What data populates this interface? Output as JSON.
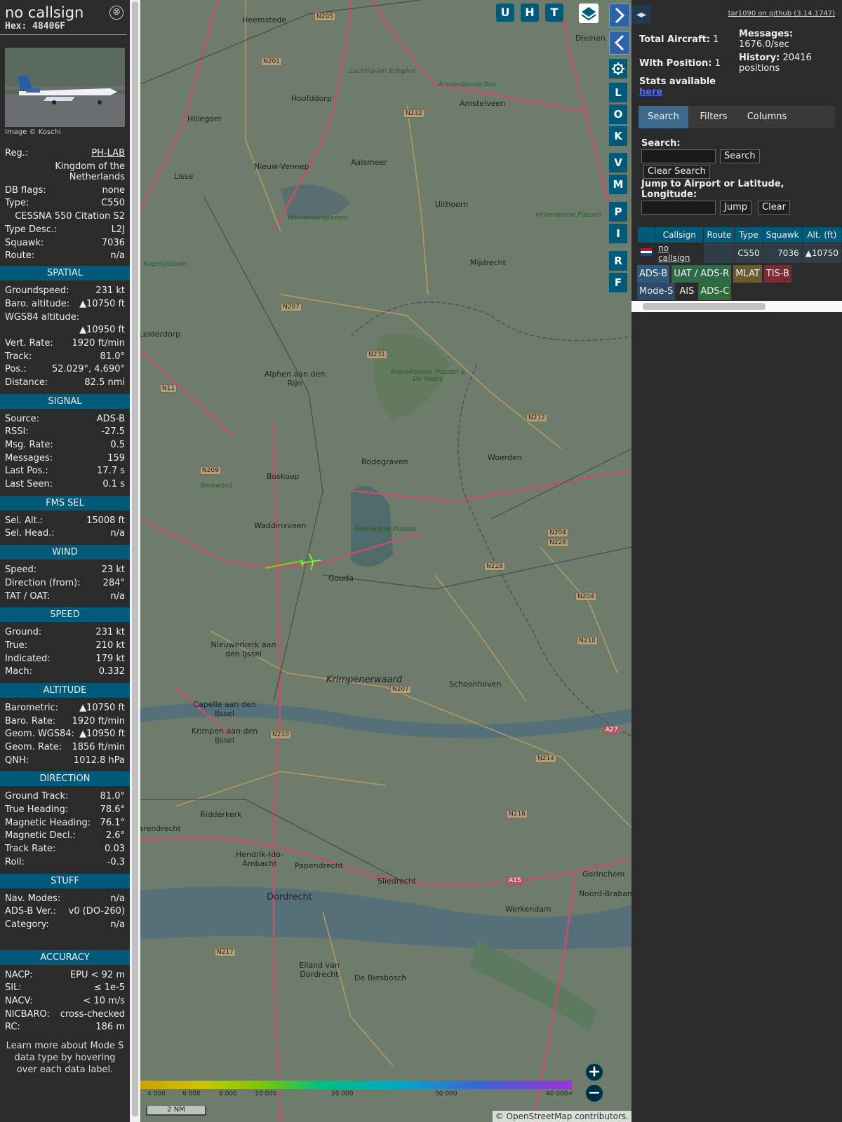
{
  "detail": {
    "callsign": "no callsign",
    "hex": "Hex: 48406F",
    "image_credit": "Image © Koschi",
    "close_symbol": "⊗",
    "main_rows": [
      {
        "k": "Reg.:",
        "v": "PH-LAB"
      },
      {
        "k": "",
        "v": "Kingdom of the Netherlands"
      },
      {
        "k": "DB flags:",
        "v": "none"
      },
      {
        "k": "Type:",
        "v": "C550"
      },
      {
        "k": "",
        "v": "CESSNA 550 Citation S2"
      },
      {
        "k": "Type Desc.:",
        "v": "L2J"
      },
      {
        "k": "Squawk:",
        "v": "7036"
      },
      {
        "k": "Route:",
        "v": "n/a"
      }
    ],
    "sections": [
      {
        "title": "SPATIAL",
        "rows": [
          {
            "k": "Groundspeed:",
            "v": "231 kt"
          },
          {
            "k": "Baro. altitude:",
            "v": "▲10750 ft"
          },
          {
            "k": "WGS84 altitude:",
            "v": ""
          },
          {
            "k": "",
            "v": "▲10950 ft"
          },
          {
            "k": "Vert. Rate:",
            "v": "1920 ft/min"
          },
          {
            "k": "Track:",
            "v": "81.0°"
          },
          {
            "k": "Pos.:",
            "v": "52.029°, 4.690°"
          },
          {
            "k": "Distance:",
            "v": "82.5 nmi"
          }
        ]
      },
      {
        "title": "SIGNAL",
        "rows": [
          {
            "k": "Source:",
            "v": "ADS-B"
          },
          {
            "k": "RSSI:",
            "v": "-27.5"
          },
          {
            "k": "Msg. Rate:",
            "v": "0.5"
          },
          {
            "k": "Messages:",
            "v": "159"
          },
          {
            "k": "Last Pos.:",
            "v": "17.7 s"
          },
          {
            "k": "Last Seen:",
            "v": "0.1 s"
          }
        ]
      },
      {
        "title": "FMS SEL",
        "rows": [
          {
            "k": "Sel. Alt.:",
            "v": "15008 ft"
          },
          {
            "k": "Sel. Head.:",
            "v": "n/a"
          }
        ]
      },
      {
        "title": "WIND",
        "rows": [
          {
            "k": "Speed:",
            "v": "23 kt"
          },
          {
            "k": "Direction (from):",
            "v": "284°"
          },
          {
            "k": "TAT / OAT:",
            "v": "n/a"
          }
        ]
      },
      {
        "title": "SPEED",
        "rows": [
          {
            "k": "Ground:",
            "v": "231 kt"
          },
          {
            "k": "True:",
            "v": "210 kt"
          },
          {
            "k": "Indicated:",
            "v": "179 kt"
          },
          {
            "k": "Mach:",
            "v": "0.332"
          }
        ]
      },
      {
        "title": "ALTITUDE",
        "rows": [
          {
            "k": "Barometric:",
            "v": "▲10750 ft"
          },
          {
            "k": "Baro. Rate:",
            "v": "1920 ft/min"
          },
          {
            "k": "Geom. WGS84:",
            "v": "▲10950 ft"
          },
          {
            "k": "Geom. Rate:",
            "v": "1856 ft/min"
          },
          {
            "k": "QNH:",
            "v": "1012.8 hPa"
          }
        ]
      },
      {
        "title": "DIRECTION",
        "rows": [
          {
            "k": "Ground Track:",
            "v": "81.0°"
          },
          {
            "k": "True Heading:",
            "v": "78.6°"
          },
          {
            "k": "Magnetic Heading:",
            "v": "76.1°"
          },
          {
            "k": "Magnetic Decl.:",
            "v": "2.6°"
          },
          {
            "k": "Track Rate:",
            "v": "0.03"
          },
          {
            "k": "Roll:",
            "v": "-0.3"
          }
        ]
      },
      {
        "title": "STUFF",
        "rows": [
          {
            "k": "Nav. Modes:",
            "v": "n/a"
          },
          {
            "k": "ADS-B Ver.:",
            "v": "v0 (DO-260)"
          },
          {
            "k": "Category:",
            "v": "n/a"
          }
        ]
      },
      {
        "title": "ACCURACY",
        "rows": [
          {
            "k": "NACP:",
            "v": "EPU < 92 m"
          },
          {
            "k": "SIL:",
            "v": "≤ 1e-5"
          },
          {
            "k": "NACV:",
            "v": "< 10 m/s"
          },
          {
            "k": "NICBARO:",
            "v": "cross-checked"
          },
          {
            "k": "RC:",
            "v": "186 m"
          }
        ]
      }
    ],
    "footer_note": "Learn more about Mode S data type by hovering over each data label."
  },
  "map": {
    "towns": [
      {
        "name": "Heemstede"
      },
      {
        "name": "Hoofddorp"
      },
      {
        "name": "Hillegom"
      },
      {
        "name": "Nieuw-Vennep"
      },
      {
        "name": "Lisse"
      },
      {
        "name": "Aalsmeer"
      },
      {
        "name": "Amstelveen"
      },
      {
        "name": "Uithoorn"
      },
      {
        "name": "Diemen"
      },
      {
        "name": "Mijdrecht"
      },
      {
        "name": "Alphen aan den Rijn"
      },
      {
        "name": "Bodegraven"
      },
      {
        "name": "Woerden"
      },
      {
        "name": "Boskoop"
      },
      {
        "name": "Waddinxveen"
      },
      {
        "name": "Gouda"
      },
      {
        "name": "Nieuwerkerk aan den IJssel"
      },
      {
        "name": "Krimpenerwaard"
      },
      {
        "name": "Schoonhoven"
      },
      {
        "name": "Capelle aan den IJssel"
      },
      {
        "name": "Krimpen aan den IJssel"
      },
      {
        "name": "Ridderkerk"
      },
      {
        "name": "Barendrecht"
      },
      {
        "name": "Hendrik-Ido-Ambacht"
      },
      {
        "name": "Papendrecht"
      },
      {
        "name": "Sliedrecht"
      },
      {
        "name": "Werkendam"
      },
      {
        "name": "Gorinchem"
      },
      {
        "name": "Dordrecht"
      },
      {
        "name": "Eiland van Dordrecht"
      },
      {
        "name": "De Biesbosch"
      },
      {
        "name": "Leiderdorp"
      },
      {
        "name": "Bentwoud"
      },
      {
        "name": "Nieuwkoopse Plassen & De Haeck"
      },
      {
        "name": "Reeuwijkse Plassen"
      },
      {
        "name": "Vinkeveense Plassen"
      },
      {
        "name": "Westeinderplassen"
      },
      {
        "name": "Amsterdamse Bos"
      },
      {
        "name": "Kagerplassen"
      },
      {
        "name": "Noord-Brabant"
      },
      {
        "name": "Luchthaven Schiphol"
      }
    ],
    "roads": [
      "N205",
      "N201",
      "N232",
      "N207",
      "N231",
      "N11",
      "N209",
      "N212",
      "N204",
      "N228",
      "N228",
      "N204",
      "N210",
      "N207",
      "N210",
      "N214",
      "N216",
      "A15",
      "N217",
      "A27"
    ],
    "aircraft_label": "plane-marker",
    "map_buttons": [
      "U",
      "H",
      "T"
    ],
    "side_buttons": [
      "L",
      "O",
      "K",
      "V",
      "M",
      "P",
      "I",
      "R",
      "F"
    ],
    "zoom_in": "+",
    "zoom_out": "−",
    "scale": "2 NM",
    "attribution": "© OpenStreetMap contributors.",
    "altitude_labels": [
      "4 000",
      "6 000",
      "8 000",
      "10 000",
      "20 000",
      "30 000",
      "40 000+"
    ]
  },
  "right": {
    "github_link": "tar1090 on github (3.14.1747)",
    "total_aircraft_label": "Total Aircraft:",
    "total_aircraft": "1",
    "messages_label": "Messages:",
    "messages": "1676.0/sec",
    "with_position_label": "With Position:",
    "with_position": "1",
    "history_label": "History:",
    "history": "20416 positions",
    "stats_label": "Stats available",
    "stats_link": "here",
    "tabs": [
      "Search",
      "Filters",
      "Columns"
    ],
    "search_label": "Search:",
    "search_button": "Search",
    "clear_search_button": "Clear Search",
    "jump_label": "Jump to Airport or Latitude, Longitude:",
    "jump_button": "Jump",
    "clear_button": "Clear",
    "table_headers": [
      "Callsign",
      "Route",
      "Type",
      "Squawk",
      "Alt. (ft)"
    ],
    "table_row": {
      "callsign": "no callsign",
      "route": "",
      "type": "C550",
      "squawk": "7036",
      "alt": "▲10750"
    },
    "legend": [
      {
        "label": "ADS-B",
        "color": "#2e5a78"
      },
      {
        "label": "UAT / ADS-R",
        "color": "#2e6a4a"
      },
      {
        "label": "MLAT",
        "color": "#6a5a30"
      },
      {
        "label": "TIS-B",
        "color": "#7a2a32"
      },
      {
        "label": "Mode-S",
        "color": "#2e4a6a"
      },
      {
        "label": "AIS",
        "color": "#2b2b2b"
      },
      {
        "label": "ADS-C",
        "color": "#2e6a3a"
      }
    ]
  }
}
